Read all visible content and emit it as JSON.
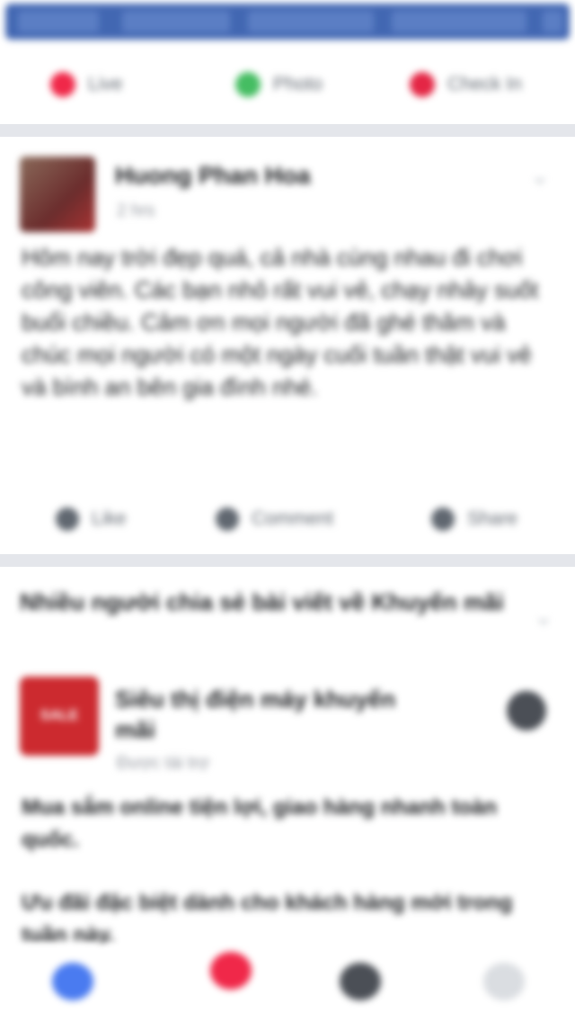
{
  "composer": {
    "live_label": "Live",
    "photo_label": "Photo",
    "checkin_label": "Check In",
    "colors": {
      "live": "#f02849",
      "photo": "#45bd62",
      "checkin": "#e42645"
    }
  },
  "post1": {
    "author": "Huong Phan Hoa",
    "timestamp": "2 hrs",
    "text": "Hôm nay trời đẹp quá, cả nhà cùng nhau đi chơi công viên. Các bạn nhỏ rất vui vẻ, chạy nhảy suốt buổi chiều. Cảm ơn mọi người đã ghé thăm và chúc mọi người có một ngày cuối tuần thật vui vẻ và bình an bên gia đình nhé.",
    "like_label": "Like",
    "comment_label": "Comment",
    "share_label": "Share"
  },
  "post2": {
    "header": "Nhiều người chia sẻ bài viết về Khuyến mãi",
    "logo_text": "SALE",
    "page_name": "Siêu thị điện máy khuyến mãi",
    "sponsored": "Được tài trợ",
    "text_line1": "Mua sắm online tiện lợi, giao hàng nhanh toàn quốc.",
    "text_line2": "Ưu đãi đặc biệt dành cho khách hàng mới trong tuần này."
  },
  "brand_color": "#4267b2",
  "bottom_nav": {
    "items": [
      "home-icon",
      "video-icon",
      "groups-icon",
      "menu-icon"
    ]
  }
}
